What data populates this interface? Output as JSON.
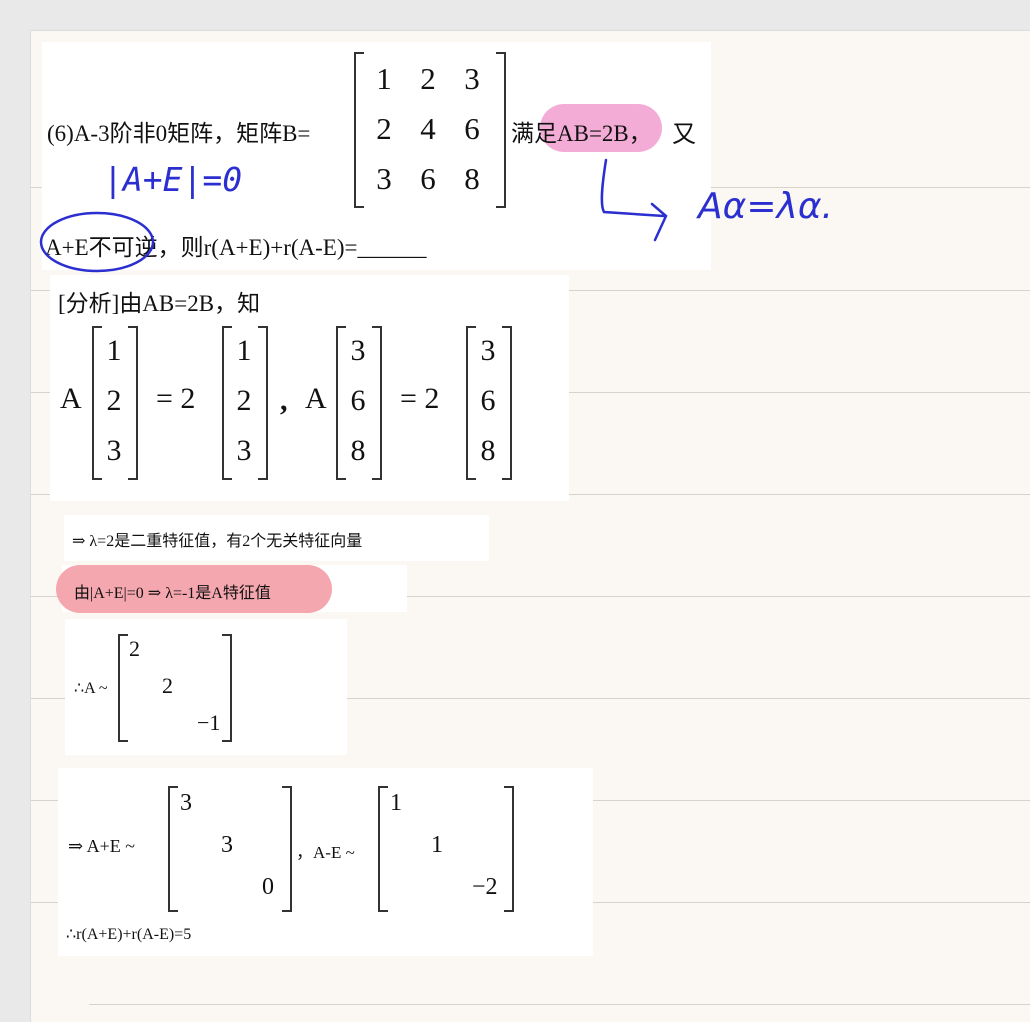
{
  "colors": {
    "pink_highlight": "#f2a3d2",
    "red_highlight": "#f3a2ab",
    "ink_blue": "#2b2fd0"
  },
  "problem": {
    "prefix": "(6)A-3阶非0矩阵，矩阵B=",
    "matrix_b": [
      [
        "1",
        "2",
        "3"
      ],
      [
        "2",
        "4",
        "6"
      ],
      [
        "3",
        "6",
        "8"
      ]
    ],
    "condition": "满足AB=2B，",
    "condition_tail": "又",
    "line2": "A+E不可逆，则r(A+E)+r(A-E)=______"
  },
  "handwriting": {
    "det_note": "|A+E|=0",
    "eigen_note": "Aα=λα."
  },
  "analysis": {
    "heading": "[分析]由AB=2B，知",
    "eq1_left": "A",
    "col1": [
      "1",
      "2",
      "3"
    ],
    "eq_sign": "= 2",
    "comma": ",",
    "eq2_left": "A",
    "col2": [
      "3",
      "6",
      "8"
    ]
  },
  "step1": "⇒ λ=2是二重特征值，有2个无关特征向量",
  "step2": "由|A+E|=0 ⇒ λ=-1是A特征值",
  "step3": {
    "prefix": "∴A ~",
    "diag": [
      "2",
      "2",
      "−1"
    ]
  },
  "step4": {
    "prefix1": "⇒ A+E ~",
    "diag1": [
      "3",
      "3",
      "0"
    ],
    "sep": "，A-E ~",
    "diag2": [
      "1",
      "1",
      "−2"
    ],
    "conclusion": "∴r(A+E)+r(A-E)=5"
  }
}
